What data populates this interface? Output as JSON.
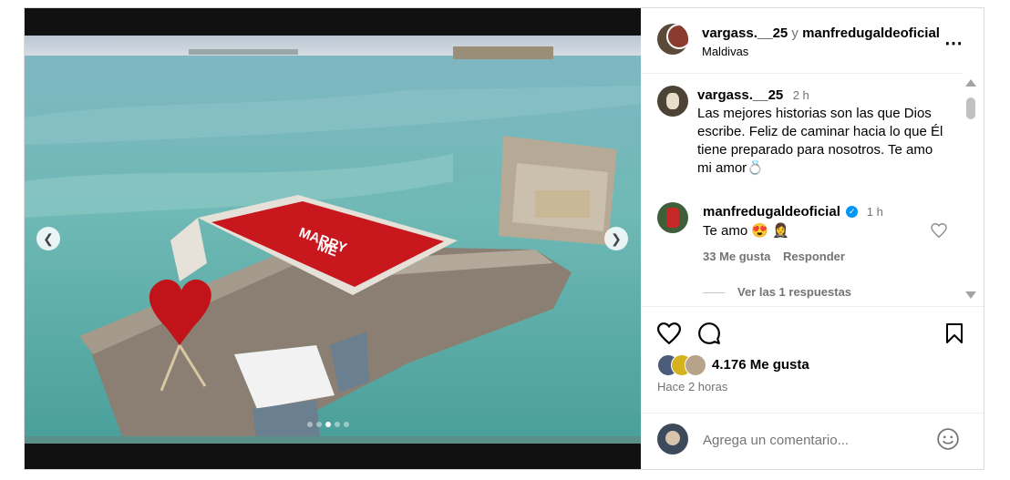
{
  "header": {
    "user1": "vargass.__25",
    "connector": "y",
    "user2": "manfredugaldeoficial",
    "location": "Maldivas",
    "more_icon": "more-horizontal-icon"
  },
  "caption": {
    "username": "vargass.__25",
    "time": "2 h",
    "text": "Las mejores historias son las que Dios escribe. Feliz de caminar hacia lo que Él tiene preparado para nosotros. Te amo mi amor💍"
  },
  "comment": {
    "username": "manfredugaldeoficial",
    "time": "1 h",
    "text": "Te amo 😍 🤵‍♀️",
    "likes": "33 Me gusta",
    "reply": "Responder",
    "view_replies": "Ver las 1 respuestas"
  },
  "sign_text": [
    "MARRY",
    "ME"
  ],
  "actions": {
    "likes": "4.176 Me gusta",
    "time_ago": "Hace 2 horas"
  },
  "composer": {
    "placeholder": "Agrega un comentario..."
  },
  "carousel": {
    "slides": 5,
    "active": 3
  },
  "colors": {
    "verified": "#0095f6",
    "accent_red": "#d01818"
  }
}
